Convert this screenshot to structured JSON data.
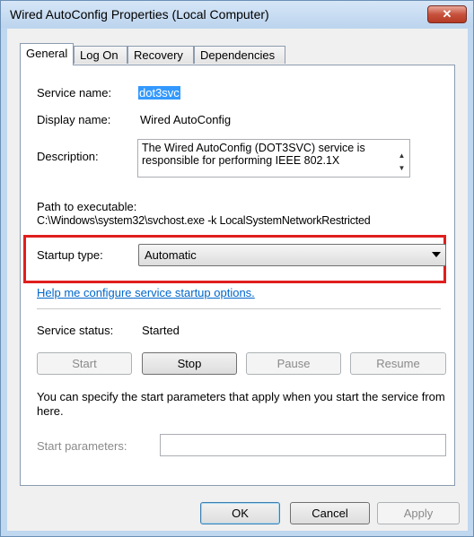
{
  "window": {
    "title": "Wired AutoConfig Properties (Local Computer)",
    "close_glyph": "✕"
  },
  "tabs": [
    {
      "label": "General"
    },
    {
      "label": "Log On"
    },
    {
      "label": "Recovery"
    },
    {
      "label": "Dependencies"
    }
  ],
  "general": {
    "service_name_label": "Service name:",
    "service_name_value": "dot3svc",
    "display_name_label": "Display name:",
    "display_name_value": "Wired AutoConfig",
    "description_label": "Description:",
    "description_line1": "The Wired AutoConfig (DOT3SVC) service is",
    "description_line2": "responsible for performing IEEE 802.1X",
    "path_label": "Path to executable:",
    "path_value": "C:\\Windows\\system32\\svchost.exe -k LocalSystemNetworkRestricted",
    "startup_type_label": "Startup type:",
    "startup_type_value": "Automatic",
    "help_link": "Help me configure service startup options.",
    "service_status_label": "Service status:",
    "service_status_value": "Started",
    "start_params_info": "You can specify the start parameters that apply when you start the service from here.",
    "start_params_label": "Start parameters:",
    "start_params_value": ""
  },
  "service_buttons": {
    "start": "Start",
    "stop": "Stop",
    "pause": "Pause",
    "resume": "Resume"
  },
  "dialog_buttons": {
    "ok": "OK",
    "cancel": "Cancel",
    "apply": "Apply"
  },
  "colors": {
    "highlight_border": "#e01e1e",
    "link": "#0066cc",
    "selection": "#3399ff"
  }
}
